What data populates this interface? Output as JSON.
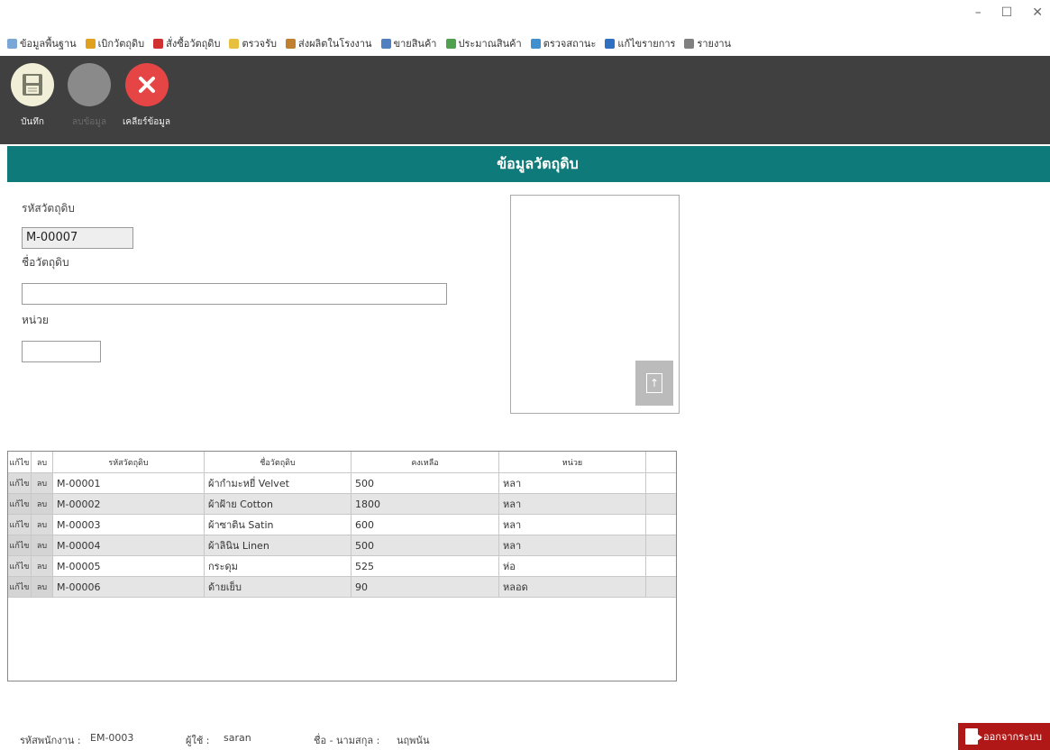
{
  "window": {
    "minimize": "–",
    "maximize": "☐",
    "close": "✕"
  },
  "menu": [
    {
      "label": "ข้อมูลพื้นฐาน",
      "color": "#7aa7d6"
    },
    {
      "label": "เบิกวัตถุดิบ",
      "color": "#e0a020"
    },
    {
      "label": "สั่งซื้อวัตถุดิบ",
      "color": "#d03030"
    },
    {
      "label": "ตรวจรับ",
      "color": "#e8c040"
    },
    {
      "label": "ส่งผลิตในโรงงาน",
      "color": "#c08030"
    },
    {
      "label": "ขายสินค้า",
      "color": "#5080c0"
    },
    {
      "label": "ประมาณสินค้า",
      "color": "#50a050"
    },
    {
      "label": "ตรวจสถานะ",
      "color": "#4090d0"
    },
    {
      "label": "แก้ไขรายการ",
      "color": "#3070c0"
    },
    {
      "label": "รายงาน",
      "color": "#808080"
    }
  ],
  "toolbar": {
    "save_label": "บันทึก",
    "delete_label": "ลบข้อมูล",
    "clear_label": "เคลียร์ข้อมูล"
  },
  "page": {
    "title": "ข้อมูลวัตถุดิบ"
  },
  "form": {
    "code_label": "รหัสวัตถุดิบ",
    "code_value": "M-00007",
    "name_label": "ชื่อวัตถุดิบ",
    "name_value": "",
    "unit_label": "หน่วย",
    "unit_value": ""
  },
  "grid": {
    "headers": [
      "แก้ไข",
      "ลบ",
      "รหัสวัตถุดิบ",
      "ชื่อวัตถุดิบ",
      "คงเหลือ",
      "หน่วย"
    ],
    "edit_label": "แก้ไข",
    "delete_label": "ลบ",
    "rows": [
      {
        "code": "M-00001",
        "name": "ผ้ากำมะหยี่ Velvet",
        "qty": "500",
        "unit": "หลา"
      },
      {
        "code": "M-00002",
        "name": "ผ้าฝ้าย Cotton",
        "qty": "1800",
        "unit": "หลา"
      },
      {
        "code": "M-00003",
        "name": "ผ้าซาติน Satin",
        "qty": "600",
        "unit": "หลา"
      },
      {
        "code": "M-00004",
        "name": "ผ้าลินิน Linen",
        "qty": "500",
        "unit": "หลา"
      },
      {
        "code": "M-00005",
        "name": "กระดุม",
        "qty": "525",
        "unit": "ห่อ"
      },
      {
        "code": "M-00006",
        "name": "ด้ายเย็บ",
        "qty": "90",
        "unit": "หลอด"
      }
    ]
  },
  "status": {
    "emp_code_label": "รหัสพนักงาน :",
    "emp_code_value": "EM-0003",
    "user_label": "ผู้ใช้ :",
    "user_value": "saran",
    "fullname_label": "ชื่อ - นามสกุล :",
    "fullname_value": "นฤพนัน",
    "logout_label": "ออกจากระบบ"
  }
}
